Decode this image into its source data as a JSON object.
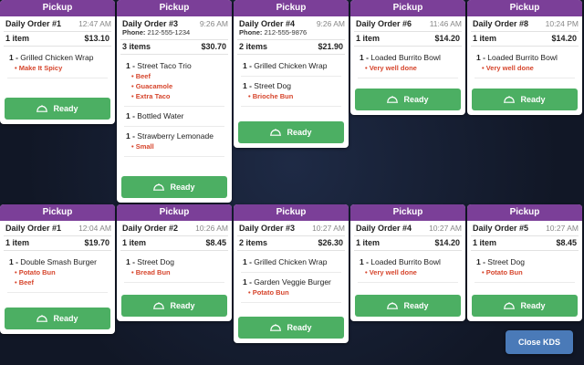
{
  "orders": [
    {
      "header": "Pickup",
      "name": "Daily Order #1",
      "time": "12:47 AM",
      "phone": null,
      "count": "1 item",
      "total": "$13.10",
      "items": [
        {
          "qty": "1",
          "name": "Grilled Chicken Wrap",
          "mods": [
            "Make It Spicy"
          ]
        }
      ],
      "button": "Ready"
    },
    {
      "header": "Pickup",
      "name": "Daily Order #3",
      "time": "9:26 AM",
      "phone": {
        "label": "Phone:",
        "value": "212-555-1234"
      },
      "count": "3 items",
      "total": "$30.70",
      "items": [
        {
          "qty": "1",
          "name": "Street Taco Trio",
          "mods": [
            "Beef",
            "Guacamole",
            "Extra Taco"
          ]
        },
        {
          "qty": "1",
          "name": "Bottled Water",
          "mods": []
        },
        {
          "qty": "1",
          "name": "Strawberry Lemonade",
          "mods": [
            "Small"
          ]
        }
      ],
      "button": "Ready"
    },
    {
      "header": "Pickup",
      "name": "Daily Order #4",
      "time": "9:26 AM",
      "phone": {
        "label": "Phone:",
        "value": "212-555-9876"
      },
      "count": "2 items",
      "total": "$21.90",
      "items": [
        {
          "qty": "1",
          "name": "Grilled Chicken Wrap",
          "mods": []
        },
        {
          "qty": "1",
          "name": "Street Dog",
          "mods": [
            "Brioche Bun"
          ]
        }
      ],
      "button": "Ready"
    },
    {
      "header": "Pickup",
      "name": "Daily Order #6",
      "time": "11:46 AM",
      "phone": null,
      "count": "1 item",
      "total": "$14.20",
      "items": [
        {
          "qty": "1",
          "name": "Loaded Burrito Bowl",
          "mods": [
            "Very well done"
          ]
        }
      ],
      "button": "Ready"
    },
    {
      "header": "Pickup",
      "name": "Daily Order #8",
      "time": "10:24 PM",
      "phone": null,
      "count": "1 item",
      "total": "$14.20",
      "items": [
        {
          "qty": "1",
          "name": "Loaded Burrito Bowl",
          "mods": [
            "Very well done"
          ]
        }
      ],
      "button": "Ready"
    },
    {
      "header": "Pickup",
      "name": "Daily Order #1",
      "time": "12:04 AM",
      "phone": null,
      "count": "1 item",
      "total": "$19.70",
      "items": [
        {
          "qty": "1",
          "name": "Double Smash Burger",
          "mods": [
            "Potato Bun",
            "Beef"
          ]
        }
      ],
      "button": "Ready"
    },
    {
      "header": "Pickup",
      "name": "Daily Order #2",
      "time": "10:26 AM",
      "phone": null,
      "count": "1 item",
      "total": "$8.45",
      "items": [
        {
          "qty": "1",
          "name": "Street Dog",
          "mods": [
            "Bread Bun"
          ]
        }
      ],
      "button": "Ready"
    },
    {
      "header": "Pickup",
      "name": "Daily Order #3",
      "time": "10:27 AM",
      "phone": null,
      "count": "2 items",
      "total": "$26.30",
      "items": [
        {
          "qty": "1",
          "name": "Grilled Chicken Wrap",
          "mods": []
        },
        {
          "qty": "1",
          "name": "Garden Veggie Burger",
          "mods": [
            "Potato Bun"
          ]
        }
      ],
      "button": "Ready"
    },
    {
      "header": "Pickup",
      "name": "Daily Order #4",
      "time": "10:27 AM",
      "phone": null,
      "count": "1 item",
      "total": "$14.20",
      "items": [
        {
          "qty": "1",
          "name": "Loaded Burrito Bowl",
          "mods": [
            "Very well done"
          ]
        }
      ],
      "button": "Ready"
    },
    {
      "header": "Pickup",
      "name": "Daily Order #5",
      "time": "10:27 AM",
      "phone": null,
      "count": "1 item",
      "total": "$8.45",
      "items": [
        {
          "qty": "1",
          "name": "Street Dog",
          "mods": [
            "Potato Bun"
          ]
        }
      ],
      "button": "Ready"
    }
  ],
  "close_button": "Close KDS",
  "colors": {
    "header": "#7b3f98",
    "ready": "#4caf63",
    "modifier": "#d6452c",
    "close": "#4a7ab8"
  },
  "icons": {
    "ready": "serving-cloche-icon"
  }
}
